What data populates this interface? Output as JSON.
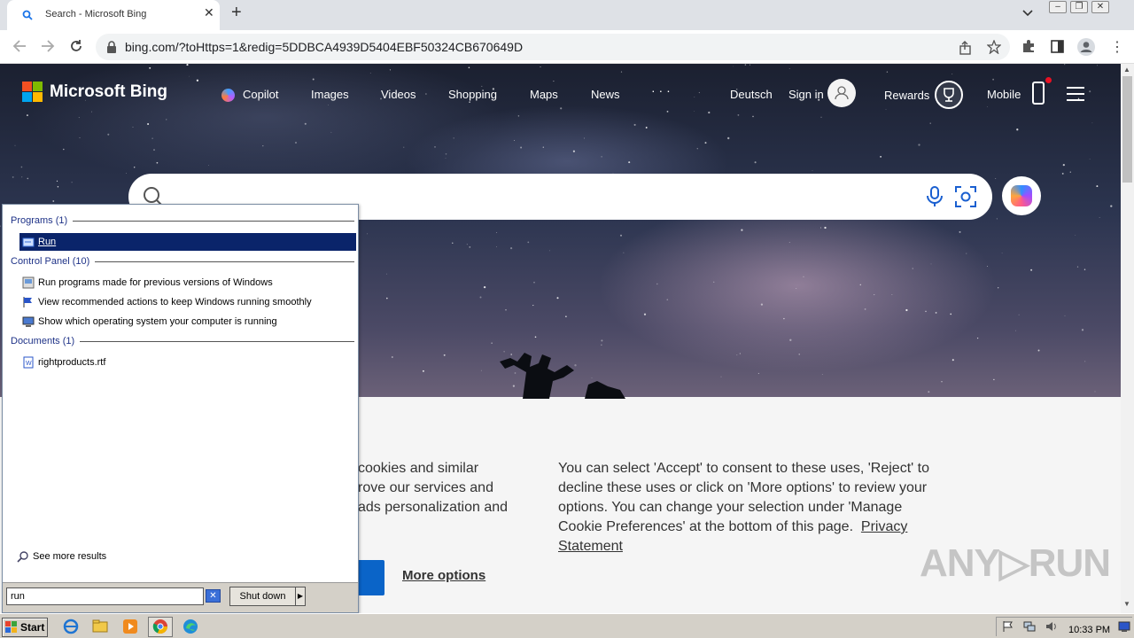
{
  "browser": {
    "tab_title": "Search - Microsoft Bing",
    "url": "bing.com/?toHttps=1&redig=5DDBCA4939D5404EBF50324CB670649D"
  },
  "bing": {
    "logo": "Microsoft Bing",
    "nav": [
      "Copilot",
      "Images",
      "Videos",
      "Shopping",
      "Maps",
      "News",
      "· · ·"
    ],
    "language": "Deutsch",
    "sign_in": "Sign in",
    "rewards": "Rewards",
    "mobile": "Mobile"
  },
  "cookie": {
    "left_lines": [
      "cookies and similar",
      "rove our services and",
      "ads personalization and"
    ],
    "right_text": "You can select 'Accept' to consent to these uses, 'Reject' to decline these uses or click on 'More options' to review your options. You can change your selection under 'Manage Cookie Preferences' at the bottom of this page.",
    "privacy_link": "Privacy Statement",
    "more_options": "More options"
  },
  "watermark": "ANY▷RUN",
  "start_menu": {
    "programs_header": "Programs (1)",
    "programs": [
      "Run"
    ],
    "control_panel_header": "Control Panel (10)",
    "control_panel": [
      "Run programs made for previous versions of Windows",
      "View recommended actions to keep Windows running smoothly",
      "Show which operating system your computer is running"
    ],
    "documents_header": "Documents (1)",
    "documents": [
      "rightproducts.rtf"
    ],
    "see_more": "See more results",
    "search_value": "run",
    "shutdown": "Shut down"
  },
  "taskbar": {
    "start": "Start",
    "clock": "10:33 PM"
  },
  "colors": {
    "selection": "#0a246a",
    "bing_blue": "#0a64c8",
    "taskbar": "#d4d0c8"
  }
}
